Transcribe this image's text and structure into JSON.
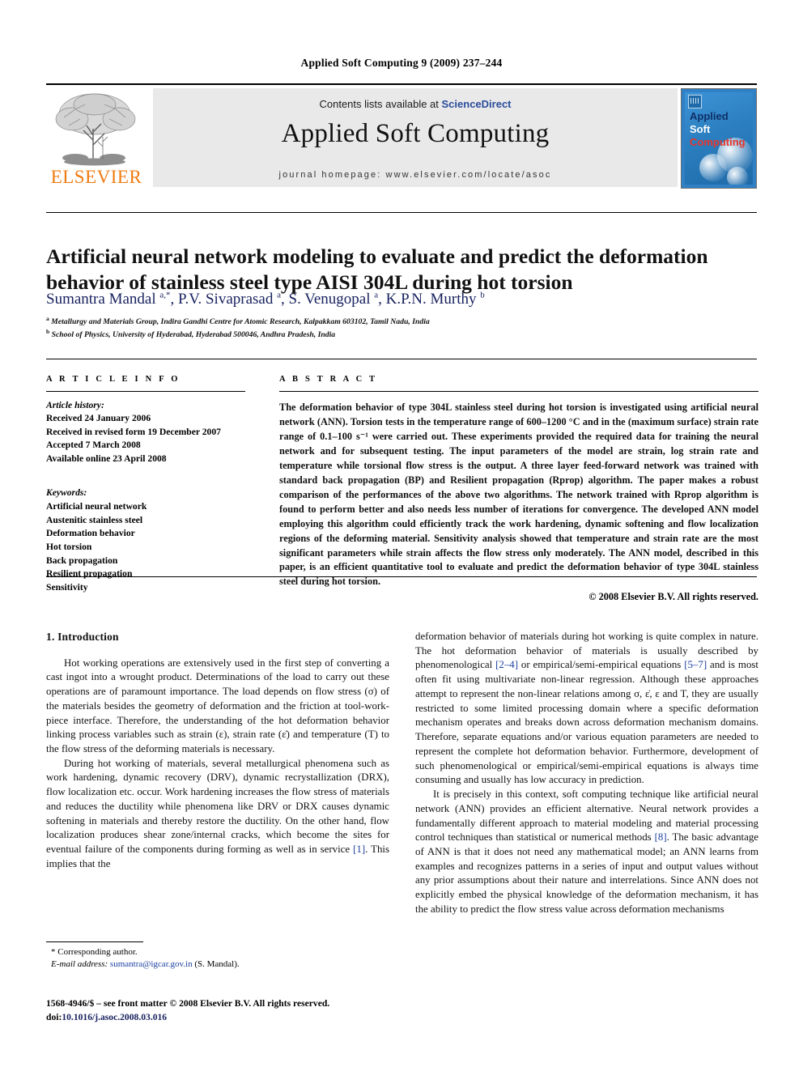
{
  "running_head": "Applied Soft Computing 9 (2009) 237–244",
  "masthead": {
    "contents_prefix": "Contents lists available at ",
    "sciencedirect": "ScienceDirect",
    "journal_title": "Applied Soft Computing",
    "homepage": "journal homepage: www.elsevier.com/locate/asoc",
    "publisher_wordmark": "ELSEVIER",
    "cover": {
      "line1": "Applied",
      "line2": "Soft",
      "line3": "Computing"
    },
    "colors": {
      "elsevier_orange": "#ef7b10",
      "sciencedirect_blue": "#2b4c9b",
      "cover_blue": "#2f80c4",
      "cover_applied": "#0f2f66",
      "cover_soft": "#ffffff",
      "cover_computing": "#e8342a",
      "band_grey": "#e9e9e9"
    }
  },
  "article": {
    "title": "Artificial neural network modeling to evaluate and predict the deformation behavior of stainless steel type AISI 304L during hot torsion",
    "authors_html": "Sumantra Mandal <sup>a,*</sup>, P.V. Sivaprasad <sup>a</sup>, S. Venugopal <sup>a</sup>, K.P.N. Murthy <sup>b</sup>",
    "affiliations": [
      {
        "marker": "a",
        "text": "Metallurgy and Materials Group, Indira Gandhi Centre for Atomic Research, Kalpakkam 603102, Tamil Nadu, India"
      },
      {
        "marker": "b",
        "text": "School of Physics, University of Hyderabad, Hyderabad 500046, Andhra Pradesh, India"
      }
    ]
  },
  "article_info": {
    "heading": "A R T I C L E  I N F O",
    "history_label": "Article history:",
    "history": [
      "Received 24 January 2006",
      "Received in revised form 19 December 2007",
      "Accepted 7 March 2008",
      "Available online 23 April 2008"
    ],
    "keywords_label": "Keywords:",
    "keywords": [
      "Artificial neural network",
      "Austenitic stainless steel",
      "Deformation behavior",
      "Hot torsion",
      "Back propagation",
      "Resilient propagation",
      "Sensitivity"
    ]
  },
  "abstract": {
    "heading": "A B S T R A C T",
    "text": "The deformation behavior of type 304L stainless steel during hot torsion is investigated using artificial neural network (ANN). Torsion tests in the temperature range of 600–1200 °C and in the (maximum surface) strain rate range of 0.1–100 s⁻¹ were carried out. These experiments provided the required data for training the neural network and for subsequent testing. The input parameters of the model are strain, log strain rate and temperature while torsional flow stress is the output. A three layer feed-forward network was trained with standard back propagation (BP) and Resilient propagation (Rprop) algorithm. The paper makes a robust comparison of the performances of the above two algorithms. The network trained with Rprop algorithm is found to perform better and also needs less number of iterations for convergence. The developed ANN model employing this algorithm could efficiently track the work hardening, dynamic softening and flow localization regions of the deforming material. Sensitivity analysis showed that temperature and strain rate are the most significant parameters while strain affects the flow stress only moderately. The ANN model, described in this paper, is an efficient quantitative tool to evaluate and predict the deformation behavior of type 304L stainless steel during hot torsion.",
    "copyright": "© 2008 Elsevier B.V. All rights reserved."
  },
  "body": {
    "section_title": "1. Introduction",
    "left_paragraphs": [
      "Hot working operations are extensively used in the first step of converting a cast ingot into a wrought product. Determinations of the load to carry out these operations are of paramount importance. The load depends on flow stress (σ) of the materials besides the geometry of deformation and the friction at tool-work-piece interface. Therefore, the understanding of the hot deformation behavior linking process variables such as strain (ε), strain rate (ε̇) and temperature (T) to the flow stress of the deforming materials is necessary.",
      "During hot working of materials, several metallurgical phenomena such as work hardening, dynamic recovery (DRV), dynamic recrystallization (DRX), flow localization etc. occur. Work hardening increases the flow stress of materials and reduces the ductility while phenomena like DRV or DRX causes dynamic softening in materials and thereby restore the ductility. On the other hand, flow localization produces shear zone/internal cracks, which become the sites for eventual failure of the components during forming as well as in service [1]. This implies that the"
    ],
    "right_paragraphs": [
      "deformation behavior of materials during hot working is quite complex in nature. The hot deformation behavior of materials is usually described by phenomenological [2–4] or empirical/semi-empirical equations [5–7] and is most often fit using multivariate non-linear regression. Although these approaches attempt to represent the non-linear relations among σ, ε̇, ε and T, they are usually restricted to some limited processing domain where a specific deformation mechanism operates and breaks down across deformation mechanism domains. Therefore, separate equations and/or various equation parameters are needed to represent the complete hot deformation behavior. Furthermore, development of such phenomenological or empirical/semi-empirical equations is always time consuming and usually has low accuracy in prediction.",
      "It is precisely in this context, soft computing technique like artificial neural network (ANN) provides an efficient alternative. Neural network provides a fundamentally different approach to material modeling and material processing control techniques than statistical or numerical methods [8]. The basic advantage of ANN is that it does not need any mathematical model; an ANN learns from examples and recognizes patterns in a series of input and output values without any prior assumptions about their nature and interrelations. Since ANN does not explicitly embed the physical knowledge of the deformation mechanism, it has the ability to predict the flow stress value across deformation mechanisms"
    ]
  },
  "footnote": {
    "corresponding_marker": "*",
    "corresponding_text": "Corresponding author.",
    "email_label": "E-mail address:",
    "email": "sumantra@igcar.gov.in",
    "email_owner": "(S. Mandal)."
  },
  "footer": {
    "issn_line": "1568-4946/$ – see front matter © 2008 Elsevier B.V. All rights reserved.",
    "doi_label": "doi:",
    "doi": "10.1016/j.asoc.2008.03.016"
  }
}
